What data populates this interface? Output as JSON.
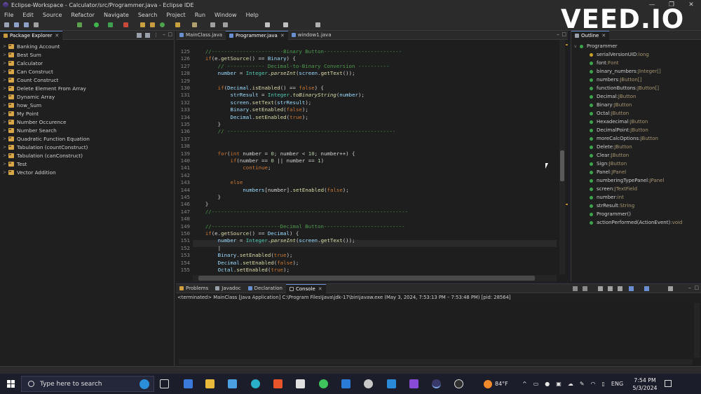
{
  "window": {
    "title": "Eclipse-Workspace - Calculator/src/Programmer.java - Eclipse IDE",
    "controls": [
      "—",
      "❐",
      "✕"
    ]
  },
  "menu": [
    "File",
    "Edit",
    "Source",
    "Refactor",
    "Navigate",
    "Search",
    "Project",
    "Run",
    "Window",
    "Help"
  ],
  "watermark": "VEED.IO",
  "package_explorer": {
    "tab": "Package Explorer",
    "items": [
      "Banking Account",
      "Best Sum",
      "Calculator",
      "Can Construct",
      "Count Construct",
      "Delete Element From Array",
      "Dynamic Array",
      "how_Sum",
      "My Point",
      "Number Occurence",
      "Number Search",
      "Quadratic Function Equation",
      "Tabulation (countConstruct)",
      "Tabulation (canConstruct)",
      "Test",
      "Vector Addition"
    ]
  },
  "editor": {
    "tabs": [
      {
        "label": "MainClass.java",
        "active": false
      },
      {
        "label": "Programmer.java",
        "active": true
      },
      {
        "label": "window1.java",
        "active": false
      }
    ],
    "lines": [
      {
        "n": "125",
        "indent": 4,
        "parts": [
          [
            "cm",
            "//-----------------------Binary Button-------------------------"
          ]
        ]
      },
      {
        "n": "126",
        "indent": 4,
        "parts": [
          [
            "kw",
            "if"
          ],
          [
            "",
            "(e."
          ],
          [
            "fn",
            "getSource"
          ],
          [
            "",
            "() == "
          ],
          [
            "fld",
            "Binary"
          ],
          [
            "",
            ") {"
          ]
        ]
      },
      {
        "n": "127",
        "indent": 8,
        "parts": [
          [
            "cm",
            "// ------------ Decimal-to-Binary Conversion ----------"
          ]
        ]
      },
      {
        "n": "128",
        "indent": 8,
        "parts": [
          [
            "fld",
            "number"
          ],
          [
            "",
            " = "
          ],
          [
            "ty",
            "Integer"
          ],
          [
            "",
            "."
          ],
          [
            "fn it",
            "parseInt"
          ],
          [
            "",
            "("
          ],
          [
            "fld",
            "screen"
          ],
          [
            "",
            "."
          ],
          [
            "fn",
            "getText"
          ],
          [
            "",
            "());"
          ]
        ]
      },
      {
        "n": "129",
        "indent": 0,
        "parts": []
      },
      {
        "n": "130",
        "indent": 8,
        "parts": [
          [
            "kw",
            "if"
          ],
          [
            "",
            "("
          ],
          [
            "fld",
            "Decimal"
          ],
          [
            "",
            "."
          ],
          [
            "fn",
            "isEnabled"
          ],
          [
            "",
            "() == "
          ],
          [
            "kw",
            "false"
          ],
          [
            "",
            ") {"
          ]
        ]
      },
      {
        "n": "131",
        "indent": 12,
        "parts": [
          [
            "fld",
            "strResult"
          ],
          [
            "",
            " = "
          ],
          [
            "ty",
            "Integer"
          ],
          [
            "",
            "."
          ],
          [
            "fn it",
            "toBinaryString"
          ],
          [
            "",
            "("
          ],
          [
            "fld",
            "number"
          ],
          [
            "",
            ");"
          ]
        ]
      },
      {
        "n": "132",
        "indent": 12,
        "parts": [
          [
            "fld",
            "screen"
          ],
          [
            "",
            "."
          ],
          [
            "fn",
            "setText"
          ],
          [
            "",
            "("
          ],
          [
            "fld",
            "strResult"
          ],
          [
            "",
            ");"
          ]
        ]
      },
      {
        "n": "133",
        "indent": 12,
        "parts": [
          [
            "fld",
            "Binary"
          ],
          [
            "",
            "."
          ],
          [
            "fn",
            "setEnabled"
          ],
          [
            "",
            "("
          ],
          [
            "kw",
            "false"
          ],
          [
            "",
            ");"
          ]
        ]
      },
      {
        "n": "134",
        "indent": 12,
        "parts": [
          [
            "fld",
            "Decimal"
          ],
          [
            "",
            "."
          ],
          [
            "fn",
            "setEnabled"
          ],
          [
            "",
            "("
          ],
          [
            "kw",
            "true"
          ],
          [
            "",
            ");"
          ]
        ]
      },
      {
        "n": "135",
        "indent": 8,
        "parts": [
          [
            "",
            "}"
          ]
        ]
      },
      {
        "n": "136",
        "indent": 8,
        "parts": [
          [
            "cm",
            "// ------------------------------------------------------"
          ]
        ]
      },
      {
        "n": "137",
        "indent": 0,
        "parts": []
      },
      {
        "n": "138",
        "indent": 0,
        "parts": []
      },
      {
        "n": "139",
        "indent": 8,
        "parts": [
          [
            "kw",
            "for"
          ],
          [
            "",
            "("
          ],
          [
            "kw",
            "int"
          ],
          [
            "",
            " number = "
          ],
          [
            "num",
            "0"
          ],
          [
            "",
            "; number < "
          ],
          [
            "num",
            "10"
          ],
          [
            "",
            "; number++) {"
          ]
        ]
      },
      {
        "n": "140",
        "indent": 12,
        "parts": [
          [
            "kw",
            "if"
          ],
          [
            "",
            "(number == "
          ],
          [
            "num",
            "0"
          ],
          [
            "",
            " || number == "
          ],
          [
            "num",
            "1"
          ],
          [
            "",
            ")"
          ]
        ]
      },
      {
        "n": "141",
        "indent": 16,
        "parts": [
          [
            "kw",
            "continue"
          ],
          [
            "",
            ";"
          ]
        ]
      },
      {
        "n": "142",
        "indent": 0,
        "parts": []
      },
      {
        "n": "143",
        "indent": 12,
        "parts": [
          [
            "kw",
            "else"
          ]
        ]
      },
      {
        "n": "144",
        "indent": 16,
        "parts": [
          [
            "fld",
            "numbers"
          ],
          [
            "",
            "[number]."
          ],
          [
            "fn",
            "setEnabled"
          ],
          [
            "",
            "("
          ],
          [
            "kw",
            "false"
          ],
          [
            "",
            ");"
          ]
        ]
      },
      {
        "n": "145",
        "indent": 8,
        "parts": [
          [
            "",
            "}"
          ]
        ]
      },
      {
        "n": "146",
        "indent": 4,
        "parts": [
          [
            "",
            "}"
          ]
        ]
      },
      {
        "n": "147",
        "indent": 4,
        "parts": [
          [
            "cm",
            "//---------------------------------------------------------------"
          ]
        ]
      },
      {
        "n": "148",
        "indent": 0,
        "parts": []
      },
      {
        "n": "149",
        "indent": 4,
        "parts": [
          [
            "cm",
            "//----------------------Decimal Button--------------------------"
          ]
        ]
      },
      {
        "n": "150",
        "indent": 4,
        "parts": [
          [
            "kw",
            "if"
          ],
          [
            "",
            "(e."
          ],
          [
            "fn",
            "getSource"
          ],
          [
            "",
            "() == "
          ],
          [
            "fld",
            "Decimal"
          ],
          [
            "",
            ") {"
          ]
        ]
      },
      {
        "n": "151",
        "indent": 8,
        "parts": [
          [
            "fld",
            "number"
          ],
          [
            "",
            " = "
          ],
          [
            "ty",
            "Integer"
          ],
          [
            "",
            "."
          ],
          [
            "fn it",
            "parseInt"
          ],
          [
            "",
            "("
          ],
          [
            "fld",
            "screen"
          ],
          [
            "",
            "."
          ],
          [
            "fn",
            "getText"
          ],
          [
            "",
            "());"
          ]
        ]
      },
      {
        "n": "152",
        "indent": 8,
        "parts": [
          [
            "",
            "|"
          ]
        ]
      },
      {
        "n": "153",
        "indent": 8,
        "parts": [
          [
            "fld",
            "Binary"
          ],
          [
            "",
            "."
          ],
          [
            "fn",
            "setEnabled"
          ],
          [
            "",
            "("
          ],
          [
            "kw",
            "true"
          ],
          [
            "",
            ");"
          ]
        ]
      },
      {
        "n": "154",
        "indent": 8,
        "parts": [
          [
            "fld",
            "Decimal"
          ],
          [
            "",
            "."
          ],
          [
            "fn",
            "setEnabled"
          ],
          [
            "",
            "("
          ],
          [
            "kw",
            "false"
          ],
          [
            "",
            ");"
          ]
        ]
      },
      {
        "n": "155",
        "indent": 8,
        "parts": [
          [
            "fld",
            "Octal"
          ],
          [
            "",
            "."
          ],
          [
            "fn",
            "setEnabled"
          ],
          [
            "",
            "("
          ],
          [
            "kw",
            "true"
          ],
          [
            "",
            ");"
          ]
        ]
      }
    ]
  },
  "outline": {
    "tab": "Outline",
    "root": "Programmer",
    "items": [
      {
        "name": "serialVersionUID",
        "type": "long",
        "color": "#c9a227"
      },
      {
        "name": "font",
        "type": "Font",
        "color": "#3fa34d"
      },
      {
        "name": "binary_numbers",
        "type": "JInteger[]",
        "color": "#3fa34d"
      },
      {
        "name": "numbers",
        "type": "JButton[]",
        "color": "#3fa34d"
      },
      {
        "name": "functionButtons",
        "type": "JButton[]",
        "color": "#3fa34d"
      },
      {
        "name": "Decimal",
        "type": "JButton",
        "color": "#3fa34d"
      },
      {
        "name": "Binary",
        "type": "JButton",
        "color": "#3fa34d"
      },
      {
        "name": "Octal",
        "type": "JButton",
        "color": "#3fa34d"
      },
      {
        "name": "Hexadecimal",
        "type": "JButton",
        "color": "#3fa34d"
      },
      {
        "name": "DecimalPoint",
        "type": "JButton",
        "color": "#3fa34d"
      },
      {
        "name": "moreCalcOptions",
        "type": "JButton",
        "color": "#3fa34d"
      },
      {
        "name": "Delete",
        "type": "JButton",
        "color": "#3fa34d"
      },
      {
        "name": "Clear",
        "type": "JButton",
        "color": "#3fa34d"
      },
      {
        "name": "Sign",
        "type": "JButton",
        "color": "#3fa34d"
      },
      {
        "name": "Panel",
        "type": "JPanel",
        "color": "#3fa34d"
      },
      {
        "name": "numberingTypePanel",
        "type": "JPanel",
        "color": "#3fa34d"
      },
      {
        "name": "screen",
        "type": "JTextField",
        "color": "#3fa34d"
      },
      {
        "name": "number",
        "type": "int",
        "color": "#3fa34d"
      },
      {
        "name": "strResult",
        "type": "String",
        "color": "#3fa34d"
      },
      {
        "name": "Programmer()",
        "type": "",
        "color": "#3fa34d"
      },
      {
        "name": "actionPerformed(ActionEvent)",
        "type": "void",
        "color": "#3fa34d"
      }
    ]
  },
  "bottom": {
    "tabs": [
      {
        "label": "Problems",
        "active": false
      },
      {
        "label": "Javadoc",
        "active": false
      },
      {
        "label": "Declaration",
        "active": false
      },
      {
        "label": "Console",
        "active": true
      }
    ],
    "console_info": "<terminated> MainClass [Java Application] C:\\Program Files\\Java\\jdk-17\\bin\\javaw.exe  (May 3, 2024, 7:53:13 PM – 7:53:48 PM) [pid: 28564]"
  },
  "taskbar": {
    "search_placeholder": "Type here to search",
    "weather": "84°F",
    "lang": "ENG",
    "time": "7:54 PM",
    "date": "5/3/2024"
  }
}
